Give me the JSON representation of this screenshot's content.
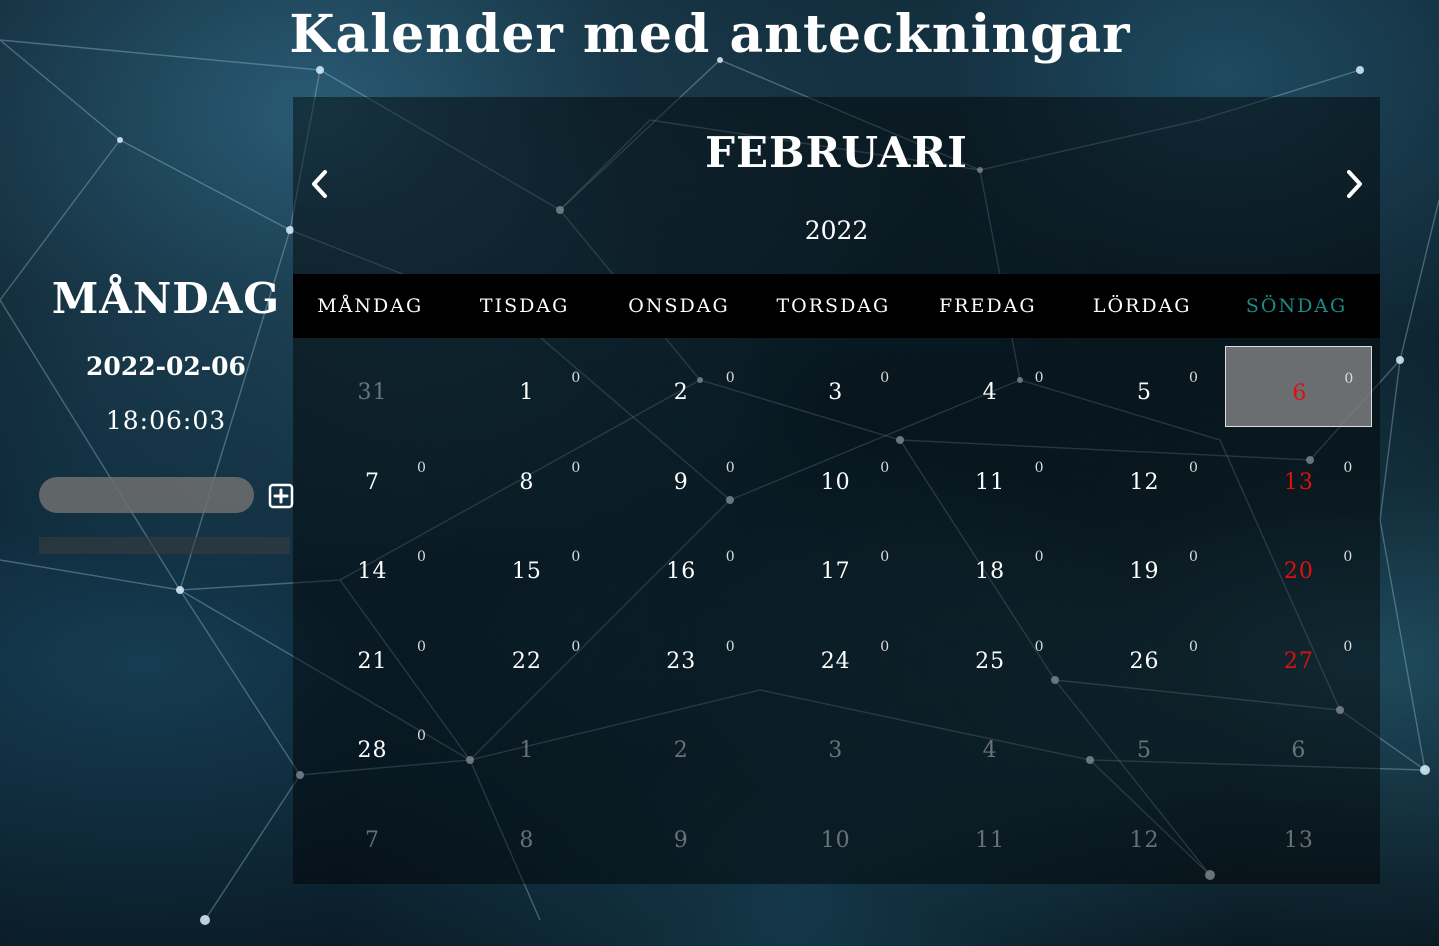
{
  "app": {
    "title": "Kalender med anteckningar"
  },
  "sidebar": {
    "weekday": "MÅNDAG",
    "date": "2022-02-06",
    "time": "18:06:03",
    "note_input": {
      "value": "",
      "placeholder": ""
    },
    "add_icon": "plus-square-icon"
  },
  "calendar": {
    "month": "FEBRUARI",
    "year": "2022",
    "prev_icon": "chevron-left-icon",
    "next_icon": "chevron-right-icon",
    "weekdays": [
      "MÅNDAG",
      "TISDAG",
      "ONSDAG",
      "TORSDAG",
      "FREDAG",
      "LÖRDAG",
      "SÖNDAG"
    ],
    "colors": {
      "sunday_header": "#1a8a8a",
      "weekend_day": "#e01010",
      "selected_bg": "#8c8c8c"
    },
    "weeks": [
      [
        {
          "day": "31",
          "count": "",
          "type": "other"
        },
        {
          "day": "1",
          "count": "0",
          "type": "current"
        },
        {
          "day": "2",
          "count": "0",
          "type": "current"
        },
        {
          "day": "3",
          "count": "0",
          "type": "current"
        },
        {
          "day": "4",
          "count": "0",
          "type": "current"
        },
        {
          "day": "5",
          "count": "0",
          "type": "current"
        },
        {
          "day": "6",
          "count": "0",
          "type": "weekend",
          "selected": true
        }
      ],
      [
        {
          "day": "7",
          "count": "0",
          "type": "current"
        },
        {
          "day": "8",
          "count": "0",
          "type": "current"
        },
        {
          "day": "9",
          "count": "0",
          "type": "current"
        },
        {
          "day": "10",
          "count": "0",
          "type": "current"
        },
        {
          "day": "11",
          "count": "0",
          "type": "current"
        },
        {
          "day": "12",
          "count": "0",
          "type": "current"
        },
        {
          "day": "13",
          "count": "0",
          "type": "weekend"
        }
      ],
      [
        {
          "day": "14",
          "count": "0",
          "type": "current"
        },
        {
          "day": "15",
          "count": "0",
          "type": "current"
        },
        {
          "day": "16",
          "count": "0",
          "type": "current"
        },
        {
          "day": "17",
          "count": "0",
          "type": "current"
        },
        {
          "day": "18",
          "count": "0",
          "type": "current"
        },
        {
          "day": "19",
          "count": "0",
          "type": "current"
        },
        {
          "day": "20",
          "count": "0",
          "type": "weekend"
        }
      ],
      [
        {
          "day": "21",
          "count": "0",
          "type": "current"
        },
        {
          "day": "22",
          "count": "0",
          "type": "current"
        },
        {
          "day": "23",
          "count": "0",
          "type": "current"
        },
        {
          "day": "24",
          "count": "0",
          "type": "current"
        },
        {
          "day": "25",
          "count": "0",
          "type": "current"
        },
        {
          "day": "26",
          "count": "0",
          "type": "current"
        },
        {
          "day": "27",
          "count": "0",
          "type": "weekend"
        }
      ],
      [
        {
          "day": "28",
          "count": "0",
          "type": "current"
        },
        {
          "day": "1",
          "count": "",
          "type": "other"
        },
        {
          "day": "2",
          "count": "",
          "type": "other"
        },
        {
          "day": "3",
          "count": "",
          "type": "other"
        },
        {
          "day": "4",
          "count": "",
          "type": "other"
        },
        {
          "day": "5",
          "count": "",
          "type": "other"
        },
        {
          "day": "6",
          "count": "",
          "type": "other"
        }
      ],
      [
        {
          "day": "7",
          "count": "",
          "type": "other"
        },
        {
          "day": "8",
          "count": "",
          "type": "other"
        },
        {
          "day": "9",
          "count": "",
          "type": "other"
        },
        {
          "day": "10",
          "count": "",
          "type": "other"
        },
        {
          "day": "11",
          "count": "",
          "type": "other"
        },
        {
          "day": "12",
          "count": "",
          "type": "other"
        },
        {
          "day": "13",
          "count": "",
          "type": "other"
        }
      ]
    ]
  }
}
